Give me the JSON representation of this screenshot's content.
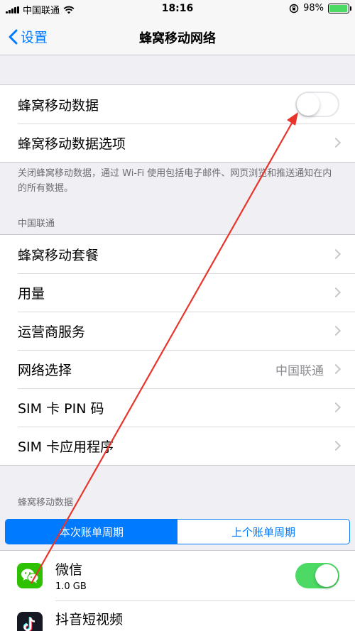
{
  "status_bar": {
    "carrier": "中国联通",
    "time": "18:16",
    "battery_percent": "98%",
    "battery_level": 0.98
  },
  "nav": {
    "back_label": "设置",
    "title": "蜂窝移动网络"
  },
  "cellular_group": {
    "data_toggle": {
      "label": "蜂窝移动数据",
      "state": "off"
    },
    "options_label": "蜂窝移动数据选项"
  },
  "footer_note": "关闭蜂窝移动数据，通过 Wi-Fi 使用包括电子邮件、网页浏览和推送通知在内的所有数据。",
  "carrier_section": {
    "header": "中国联通",
    "items": [
      {
        "label": "蜂窝移动套餐",
        "value": ""
      },
      {
        "label": "用量",
        "value": ""
      },
      {
        "label": "运营商服务",
        "value": ""
      },
      {
        "label": "网络选择",
        "value": "中国联通"
      },
      {
        "label": "SIM 卡 PIN 码",
        "value": ""
      },
      {
        "label": "SIM 卡应用程序",
        "value": ""
      }
    ]
  },
  "usage_section": {
    "header": "蜂窝移动数据",
    "segments": [
      "本次账单周期",
      "上个账单周期"
    ],
    "active_segment": 0
  },
  "apps": [
    {
      "name": "微信",
      "size": "1.0 GB",
      "toggle": "on",
      "icon": "wechat-icon",
      "color": "#2dc100"
    },
    {
      "name": "抖音短视频",
      "icon": "douyin-icon",
      "color": "#161823"
    }
  ],
  "colors": {
    "accent": "#007aff",
    "toggle_on": "#4cd964",
    "annotation": "#e8352b"
  }
}
